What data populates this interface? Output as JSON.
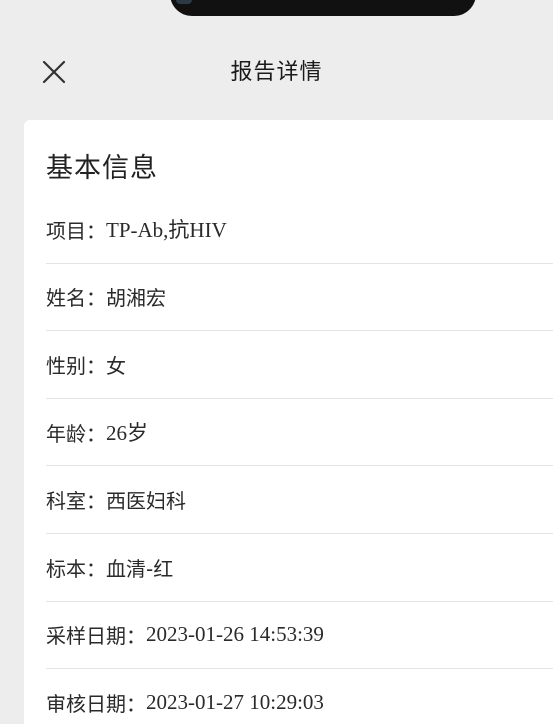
{
  "header": {
    "title": "报告详情"
  },
  "section": {
    "title": "基本信息"
  },
  "fields": [
    {
      "label": "项目：",
      "value": "TP-Ab,抗HIV"
    },
    {
      "label": "姓名：",
      "value": "胡湘宏"
    },
    {
      "label": "性别：",
      "value": "女"
    },
    {
      "label": "年龄：",
      "value": "26岁"
    },
    {
      "label": "科室：",
      "value": "西医妇科"
    },
    {
      "label": "标本：",
      "value": "血清-红"
    },
    {
      "label": "采样日期：",
      "value": "2023-01-26 14:53:39"
    },
    {
      "label": "审核日期：",
      "value": "2023-01-27 10:29:03"
    }
  ],
  "icons": {
    "close": "close-icon"
  }
}
